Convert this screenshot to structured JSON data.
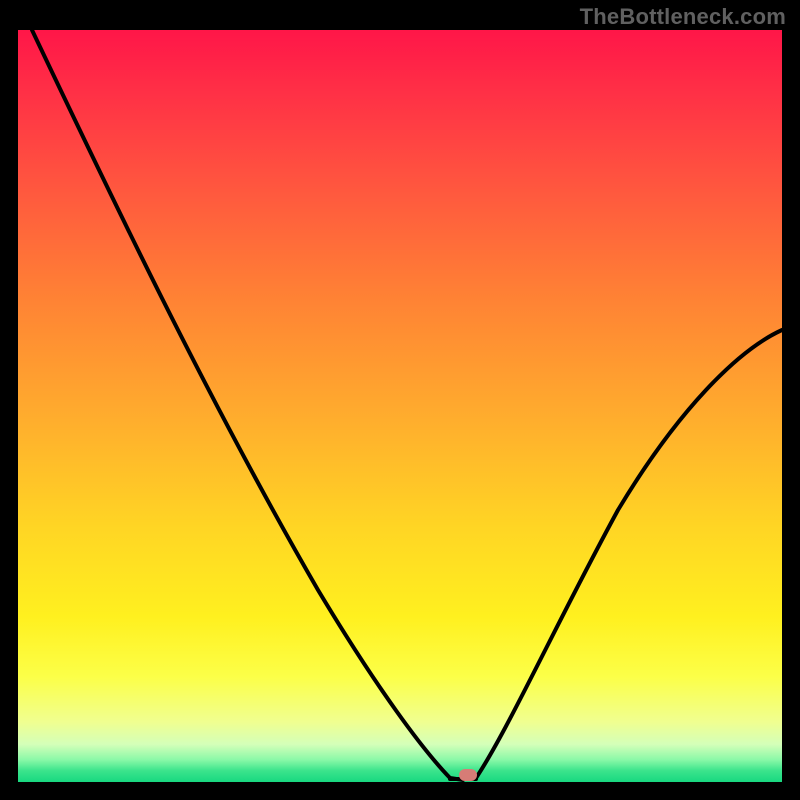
{
  "watermark": "TheBottleneck.com",
  "colors": {
    "page_bg": "#000000",
    "curve": "#000000",
    "marker": "#d67c76",
    "gradient_top": "#ff1648",
    "gradient_mid": "#ffd524",
    "gradient_bottom": "#18d880"
  },
  "chart_data": {
    "type": "line",
    "title": "",
    "xlabel": "",
    "ylabel": "",
    "xlim": [
      0,
      100
    ],
    "ylim": [
      0,
      100
    ],
    "grid": false,
    "legend": false,
    "annotations": [
      "TheBottleneck.com"
    ],
    "marker": {
      "x": 59,
      "y": 1
    },
    "series": [
      {
        "name": "bottleneck-curve",
        "x": [
          2,
          10,
          18,
          26,
          34,
          42,
          50,
          55,
          57,
          59,
          61,
          64,
          70,
          78,
          86,
          94,
          100
        ],
        "values": [
          100,
          86,
          72,
          58,
          44,
          31,
          18,
          8,
          3,
          1,
          4,
          9,
          20,
          33,
          44,
          53,
          60
        ]
      }
    ]
  }
}
